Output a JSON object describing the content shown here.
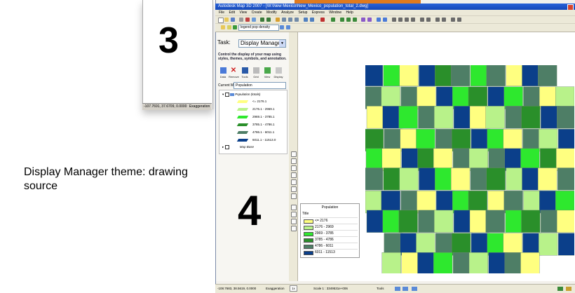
{
  "steps": {
    "step3": "3",
    "step4": "4"
  },
  "caption": "Display Manager theme: drawing source",
  "prev_screenshot": {
    "status_coords": "-107.7691, 37.6709, 0.0000",
    "status_exaggeration": "Exaggeration"
  },
  "window": {
    "title": "Autodesk Map 3D 2007 - [W:\\New Mexico\\New_Mexico_population_total_2.dwg]"
  },
  "menu": [
    "File",
    "Edit",
    "View",
    "Create",
    "Modify",
    "Analyze",
    "Setup",
    "Express",
    "Window",
    "Help"
  ],
  "toolbar": {
    "layer_value": "legend pop density"
  },
  "task_pane": {
    "label": "Task:",
    "selected": "Display Manager",
    "description": "Control the display of your map using styles, themes, symbols, and annotation.",
    "buttons": [
      "Data",
      "Remove",
      "Tools",
      "Grid",
      "View",
      "Display"
    ],
    "current_map_label": "Current Map",
    "current_map_value": "Population",
    "layers": {
      "theme_layer": "Population (totals)",
      "map_base": "Map Base",
      "ranges": [
        "<= 2176.1",
        "2176.1 - 2969.1",
        "2969.1 - 3785.1",
        "3785.1 - 4786.1",
        "4786.1 - 6011.1",
        "6011.1 - 11513.0"
      ]
    }
  },
  "legend": {
    "title": "Population",
    "header": "Title",
    "items": [
      "<= 2176",
      "2176 - 2969",
      "2969 - 3785",
      "3785 - 4786",
      "4786 - 6011",
      "6011 - 11513"
    ]
  },
  "colors": {
    "range1": "#ffff80",
    "range2": "#b8f28a",
    "range3": "#2ee82e",
    "range4": "#2a8f2a",
    "range5": "#4e7e66",
    "range6": "#0b3f8a"
  },
  "status_bar": {
    "coords": "-108.7683, 38.5619, 0.0000",
    "exaggeration_label": "Exaggeration",
    "exaggeration_value": "1x",
    "scale": "Scale 1 : 3349531e+006",
    "tools": "Tools"
  }
}
